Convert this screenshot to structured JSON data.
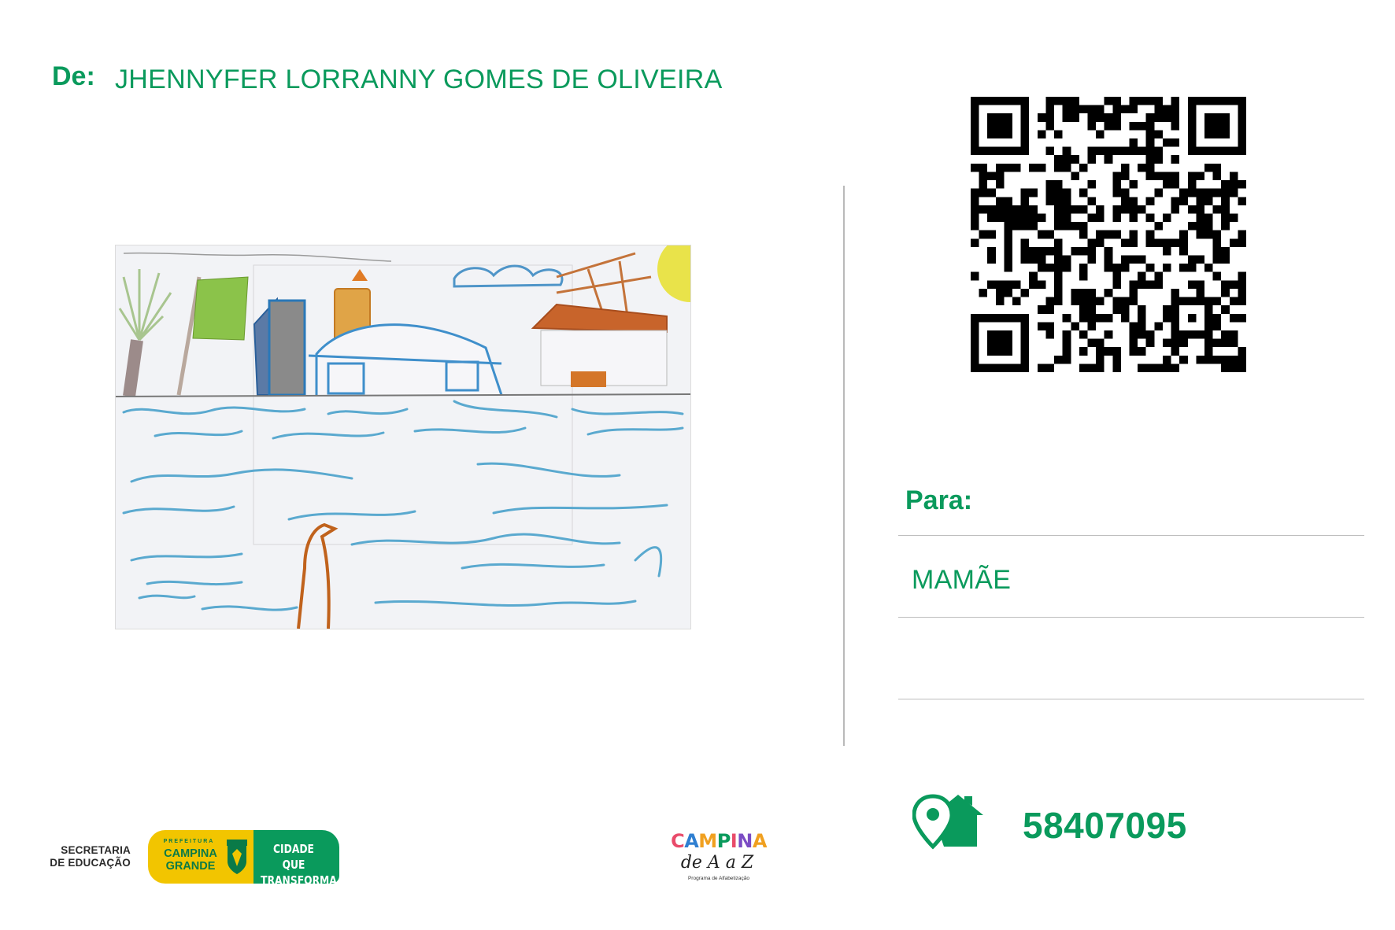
{
  "sender": {
    "label": "De:",
    "name": "JHENNYFER LORRANNY GOMES DE OLIVEIRA"
  },
  "recipient": {
    "label": "Para:",
    "name": "MAMÃE"
  },
  "postal_code": "58407095",
  "icons": {
    "address": "home-location-pin-icon",
    "qr": "qr-code"
  },
  "colors": {
    "brand_green": "#0a9a5c",
    "brand_yellow": "#f2c500",
    "divider": "#b9b9b9"
  },
  "footer": {
    "secretaria": "SECRETARIA DE EDUCAÇÃO",
    "prefeitura_small": "PREFEITURA",
    "prefeitura_city": "CAMPINA GRANDE",
    "slogan": "CIDADE QUE TRANSFORMA",
    "program_title": "CAMPINA",
    "program_sub": "de A a Z",
    "program_tag": "Programa de Alfabetização"
  }
}
